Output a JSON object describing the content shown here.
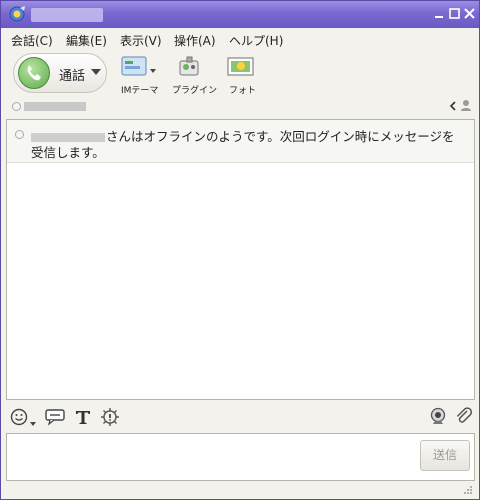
{
  "menu": {
    "items": [
      "会話(C)",
      "編集(E)",
      "表示(V)",
      "操作(A)",
      "ヘルプ(H)"
    ]
  },
  "toolbar": {
    "call_label": "通話",
    "im_theme_label": "IMテーマ",
    "plugin_label": "プラグイン",
    "photo_label": "フォト"
  },
  "conversation": {
    "notice_text": "さんはオフラインのようです。次回ログイン時にメッセージを受信します。"
  },
  "compose": {
    "send_label": "送信"
  },
  "colors": {
    "titlebar": "#7a69cf",
    "border": "#5b4aa8",
    "send_text_disabled": "#9a9a9a"
  }
}
